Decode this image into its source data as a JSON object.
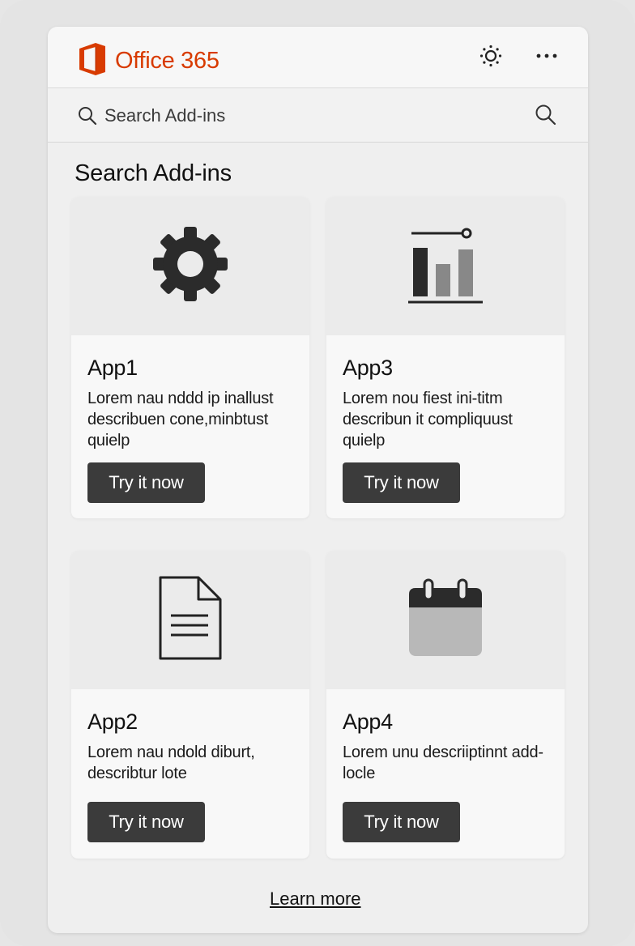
{
  "header": {
    "brand": "Office 365",
    "brand_color": "#d83b01"
  },
  "search": {
    "placeholder": "Search Add-ins"
  },
  "main": {
    "title": "Search Add-ins",
    "cards": [
      {
        "name": "App1",
        "description": "Lorem nau nddd ip inallust describuen cone,minbtust quielp",
        "button": "Try it now",
        "icon": "gear-icon"
      },
      {
        "name": "App3",
        "description": "Lorem nou fiest ini-titm describun it compliquust quielp",
        "button": "Try it now",
        "icon": "bar-chart-icon"
      },
      {
        "name": "App2",
        "description": "Lorem nau ndold diburt, describtur lote",
        "button": "Try it now",
        "icon": "document-icon"
      },
      {
        "name": "App4",
        "description": "Lorem unu descriiptinnt add-locle",
        "button": "Try it now",
        "icon": "calendar-icon"
      }
    ],
    "learn_more": "Learn more"
  }
}
